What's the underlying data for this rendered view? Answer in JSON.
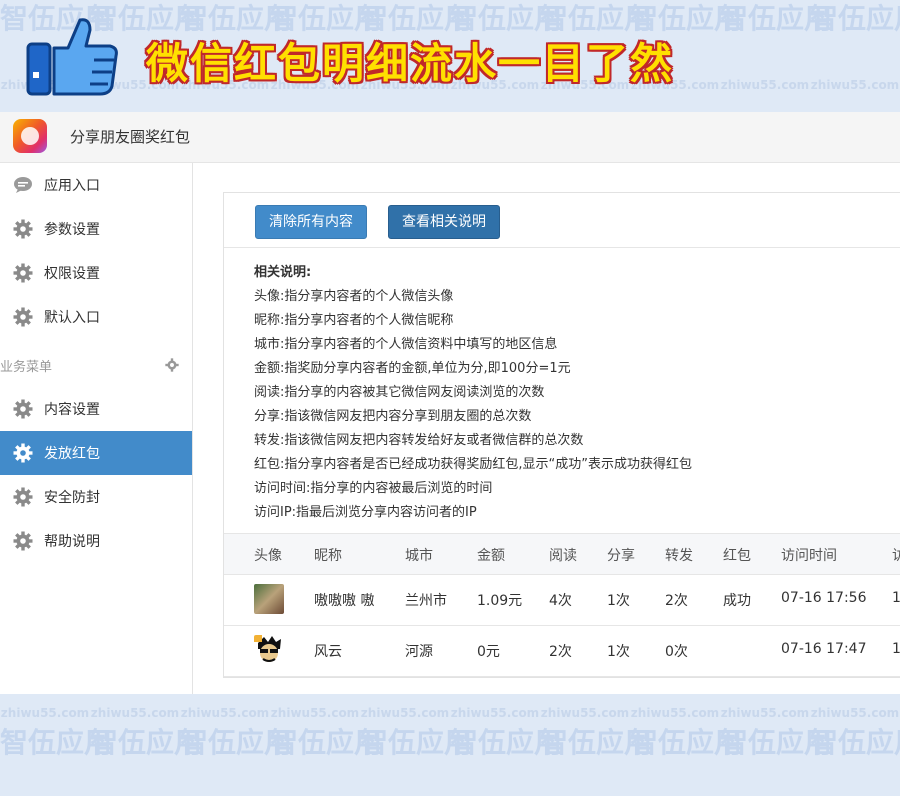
{
  "banner": {
    "title": "微信红包明细流水一目了然"
  },
  "watermark": {
    "text": "智伍应用",
    "url": "zhiwu55.com"
  },
  "app": {
    "name": "分享朋友圈奖红包"
  },
  "sidebar": {
    "items_top": [
      {
        "label": "应用入口",
        "icon": "comment-icon"
      },
      {
        "label": "参数设置",
        "icon": "gear-icon"
      },
      {
        "label": "权限设置",
        "icon": "gear-icon"
      },
      {
        "label": "默认入口",
        "icon": "gear-icon"
      }
    ],
    "section_label": "业务菜单",
    "items_bottom": [
      {
        "label": "内容设置",
        "icon": "gear-icon"
      },
      {
        "label": "发放红包",
        "icon": "gear-icon",
        "active": true
      },
      {
        "label": "安全防封",
        "icon": "gear-icon"
      },
      {
        "label": "帮助说明",
        "icon": "gear-icon"
      }
    ]
  },
  "toolbar": {
    "clear_label": "清除所有内容",
    "help_label": "查看相关说明"
  },
  "description": {
    "title": "相关说明:",
    "lines": [
      "头像:指分享内容者的个人微信头像",
      "昵称:指分享内容者的个人微信昵称",
      "城市:指分享内容者的个人微信资料中填写的地区信息",
      "金额:指奖励分享内容者的金额,单位为分,即100分=1元",
      "阅读:指分享的内容被其它微信网友阅读浏览的次数",
      "分享:指该微信网友把内容分享到朋友圈的总次数",
      "转发:指该微信网友把内容转发给好友或者微信群的总次数",
      "红包:指分享内容者是否已经成功获得奖励红包,显示“成功”表示成功获得红包",
      "访问时间:指分享的内容被最后浏览的时间",
      "访问IP:指最后浏览分享内容访问者的IP"
    ]
  },
  "table": {
    "headers": [
      "头像",
      "昵称",
      "城市",
      "金额",
      "阅读",
      "分享",
      "转发",
      "红包",
      "访问时间",
      "访"
    ],
    "rows": [
      {
        "nickname": "嗷嗷嗷 嗷",
        "city": "兰州市",
        "amount": "1.09元",
        "reads": "4次",
        "shares": "1次",
        "forwards": "2次",
        "redpack": "成功",
        "time": "07-16 17:56",
        "ip": "1"
      },
      {
        "nickname": "风云",
        "city": "河源",
        "amount": "0元",
        "reads": "2次",
        "shares": "1次",
        "forwards": "0次",
        "redpack": "",
        "time": "07-16 17:47",
        "ip": "1"
      }
    ]
  },
  "colors": {
    "accent": "#428bca",
    "accent_dark": "#3071a9",
    "banner_text": "#ffe000",
    "banner_outline": "#c0282a"
  }
}
